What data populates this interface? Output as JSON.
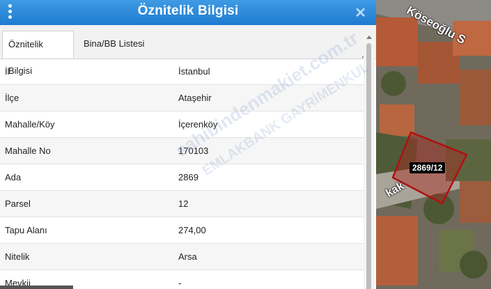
{
  "panel": {
    "title": "Öznitelik Bilgisi",
    "close_symbol": "✕",
    "tabs": [
      {
        "label": "Öznitelik Bilgisi",
        "active": true
      },
      {
        "label": "Bina/BB Listesi",
        "active": false
      }
    ]
  },
  "attributes": [
    {
      "key": "İl",
      "value": "İstanbul"
    },
    {
      "key": "İlçe",
      "value": "Ataşehir"
    },
    {
      "key": "Mahalle/Köy",
      "value": "İçerenköy"
    },
    {
      "key": "Mahalle No",
      "value": "170103"
    },
    {
      "key": "Ada",
      "value": "2869"
    },
    {
      "key": "Parsel",
      "value": "12"
    },
    {
      "key": "Tapu Alanı",
      "value": "274,00"
    },
    {
      "key": "Nitelik",
      "value": "Arsa"
    },
    {
      "key": "Mevkii",
      "value": "-"
    }
  ],
  "map": {
    "street_label": "Köseoğlu S",
    "street_label_2": "kak",
    "parcel_label": "2869/12"
  },
  "watermark": {
    "line1": "sahibindenmakiet.com.tr",
    "line2": "EMLAKBANK GAYRİMENKUL"
  },
  "colors": {
    "header_top": "#3f9be4",
    "header_bottom": "#1f7bd0",
    "parcel_outline": "#b01010"
  }
}
